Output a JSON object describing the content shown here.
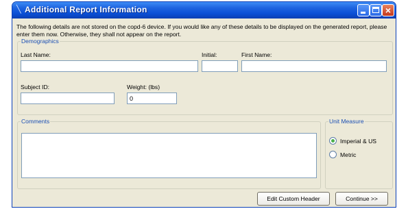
{
  "window": {
    "title": "Additional Report Information"
  },
  "intro_text": "The following details are not stored on the copd-6 device. If you would like any of these details to be displayed on the generated report, please enter them now. Otherwise, they shall not appear on the report.",
  "demographics": {
    "legend": "Demographics",
    "last_name": {
      "label": "Last Name:",
      "value": ""
    },
    "initial": {
      "label": "Initial:",
      "value": ""
    },
    "first_name": {
      "label": "First Name:",
      "value": ""
    },
    "subject_id": {
      "label": "Subject ID:",
      "value": ""
    },
    "weight": {
      "label": "Weight: (lbs)",
      "value": "0"
    }
  },
  "comments": {
    "legend": "Comments",
    "value": ""
  },
  "unit_measure": {
    "legend": "Unit Measure",
    "options": [
      {
        "label": "Imperial & US",
        "selected": true
      },
      {
        "label": "Metric",
        "selected": false
      }
    ]
  },
  "buttons": {
    "edit_custom_header": "Edit Custom Header",
    "continue": "Continue >>"
  }
}
